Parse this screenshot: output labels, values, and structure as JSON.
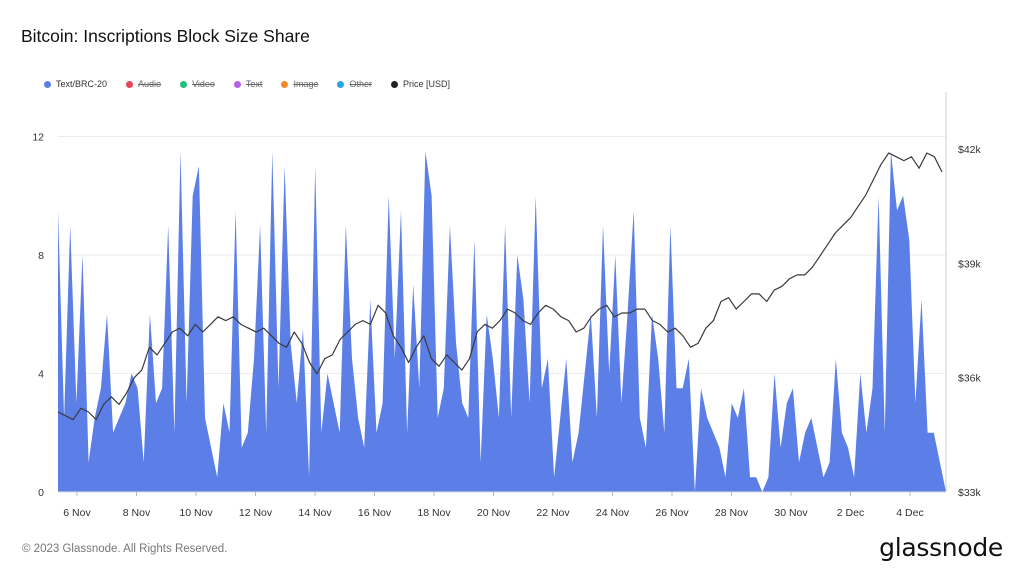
{
  "title": "Bitcoin: Inscriptions Block Size Share",
  "legend": [
    {
      "label": "Text/BRC-20",
      "color": "#5b7fe6",
      "active": true
    },
    {
      "label": "Audio",
      "color": "#e8455a",
      "active": false
    },
    {
      "label": "Video",
      "color": "#22c07a",
      "active": false
    },
    {
      "label": "Text",
      "color": "#b560e0",
      "active": false
    },
    {
      "label": "Image",
      "color": "#f08a2a",
      "active": false
    },
    {
      "label": "Other",
      "color": "#2aa5e0",
      "active": false
    },
    {
      "label": "Price [USD]",
      "color": "#222222",
      "active": true
    }
  ],
  "footer": "© 2023 Glassnode. All Rights Reserved.",
  "logo": "glassnode",
  "chart_data": {
    "type": "area",
    "x_range": [
      "2023-11-06",
      "2023-12-05"
    ],
    "xticks": [
      "6 Nov",
      "8 Nov",
      "10 Nov",
      "12 Nov",
      "14 Nov",
      "16 Nov",
      "18 Nov",
      "20 Nov",
      "22 Nov",
      "24 Nov",
      "26 Nov",
      "28 Nov",
      "30 Nov",
      "2 Dec",
      "4 Dec"
    ],
    "y_left": {
      "ticks": [
        "0",
        "4",
        "8",
        "12"
      ],
      "range": [
        0,
        13.5
      ]
    },
    "y_right": {
      "ticks": [
        "$33k",
        "$36k",
        "$39k",
        "$42k"
      ],
      "range": [
        33000,
        43500
      ]
    },
    "grid": true,
    "series": [
      {
        "name": "Text/BRC-20",
        "axis": "left",
        "color": "#5b7fe6",
        "values": [
          9.5,
          2.5,
          9.0,
          3.0,
          8.0,
          1.0,
          2.5,
          3.5,
          6.0,
          2.0,
          2.5,
          3.0,
          4.0,
          3.5,
          1.0,
          6.0,
          3.0,
          3.5,
          9.0,
          2.0,
          11.5,
          3.0,
          10.0,
          11.0,
          2.5,
          1.5,
          0.5,
          3.0,
          2.0,
          9.5,
          1.5,
          2.0,
          4.5,
          9.0,
          2.0,
          11.5,
          3.5,
          11.0,
          5.0,
          3.0,
          5.5,
          0.5,
          11.0,
          2.0,
          4.0,
          3.0,
          2.0,
          9.0,
          4.5,
          2.5,
          1.5,
          6.5,
          2.0,
          3.0,
          10.0,
          4.5,
          9.5,
          2.0,
          7.0,
          3.5,
          11.5,
          10.0,
          2.5,
          3.5,
          9.0,
          5.0,
          3.0,
          2.5,
          8.5,
          1.0,
          6.0,
          4.5,
          2.5,
          9.0,
          2.5,
          8.0,
          6.5,
          3.0,
          10.0,
          3.5,
          4.5,
          0.5,
          2.5,
          4.5,
          1.0,
          2.0,
          4.0,
          6.0,
          2.5,
          9.0,
          4.0,
          8.0,
          3.0,
          6.0,
          9.5,
          2.5,
          1.5,
          6.0,
          4.5,
          2.0,
          9.0,
          3.5,
          3.5,
          4.5,
          0.0,
          3.5,
          2.5,
          2.0,
          1.5,
          0.5,
          3.0,
          2.5,
          3.5,
          0.5,
          0.5,
          0.0,
          0.5,
          4.0,
          1.5,
          3.0,
          3.5,
          1.0,
          2.0,
          2.5,
          1.5,
          0.5,
          1.0,
          4.5,
          2.0,
          1.5,
          0.5,
          4.0,
          2.0,
          3.5,
          10.0,
          2.0,
          11.5,
          9.5,
          10.0,
          8.5,
          3.0,
          6.5,
          2.0,
          2.0,
          1.0,
          0.0
        ]
      },
      {
        "name": "Price [USD]",
        "axis": "right",
        "color": "#3a3a3a",
        "values": [
          35100,
          35000,
          34900,
          35200,
          35100,
          34900,
          35300,
          35500,
          35300,
          35600,
          36000,
          36200,
          36800,
          36600,
          36900,
          37200,
          37300,
          37100,
          37400,
          37200,
          37400,
          37600,
          37500,
          37600,
          37400,
          37300,
          37200,
          37300,
          37100,
          36900,
          36800,
          37200,
          36900,
          36400,
          36100,
          36500,
          36600,
          37000,
          37200,
          37400,
          37500,
          37400,
          37900,
          37700,
          37100,
          36800,
          36400,
          36800,
          37100,
          36500,
          36300,
          36600,
          36400,
          36200,
          36500,
          37200,
          37400,
          37300,
          37500,
          37800,
          37700,
          37500,
          37400,
          37700,
          37900,
          37800,
          37600,
          37500,
          37200,
          37300,
          37600,
          37800,
          37900,
          37600,
          37700,
          37700,
          37800,
          37800,
          37500,
          37400,
          37200,
          37300,
          37100,
          36800,
          36900,
          37300,
          37500,
          38000,
          38100,
          37800,
          38000,
          38200,
          38200,
          38000,
          38300,
          38400,
          38600,
          38700,
          38700,
          38900,
          39200,
          39500,
          39800,
          40000,
          40200,
          40500,
          40800,
          41200,
          41600,
          41900,
          41800,
          41700,
          41800,
          41500,
          41900,
          41800,
          41400
        ]
      }
    ]
  }
}
